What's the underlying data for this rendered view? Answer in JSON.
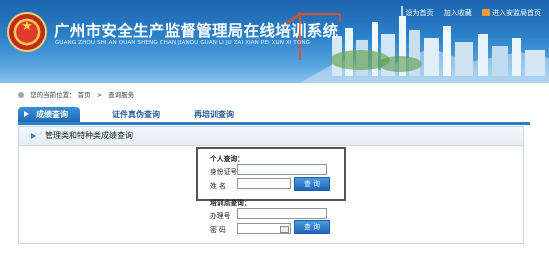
{
  "header": {
    "title": "广州市安全生产监督管理局在线培训系统",
    "subtitle": "GUANG ZHOU SHI AN QUAN SHENG CHAN JIANDU GUAN LI JU ZAI XIAN PEI XUN XI TONG",
    "links": [
      "设为首页",
      "加入收藏",
      "进入安监局首页"
    ]
  },
  "breadcrumb": {
    "prefix": "您的当前位置：",
    "home": "首页",
    "separator": ">",
    "current": "查询服务"
  },
  "tabs": [
    {
      "label": "成绩查询",
      "active": true
    },
    {
      "label": "证件真伪查询",
      "active": false
    },
    {
      "label": "再培训查询",
      "active": false
    }
  ],
  "panel": {
    "title": "管理类和特种类成绩查询",
    "personal": {
      "section_label": "个人查询：",
      "id_label": "身份证号",
      "id_value": "",
      "name_label": "姓  名",
      "name_value": "",
      "button": "查 询"
    },
    "center": {
      "section_label": "培训点查询：",
      "account_label": "办理号",
      "account_value": "",
      "password_label": "密  码",
      "password_value": "",
      "button": "查 询"
    }
  },
  "colors": {
    "header_blue": "#2c82c9",
    "tab_blue": "#2f7ec6",
    "button_blue": "#1e66b5"
  }
}
